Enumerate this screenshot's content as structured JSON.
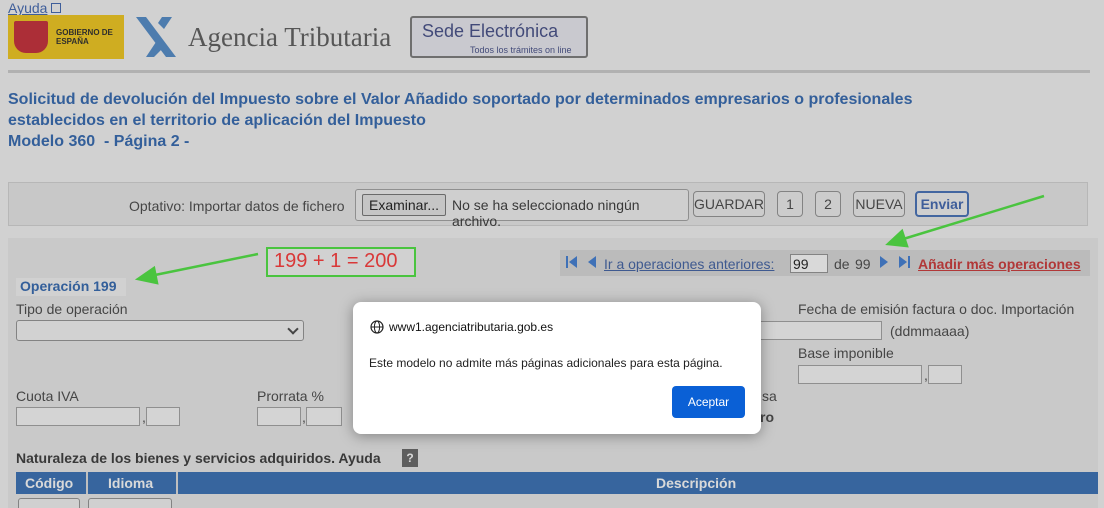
{
  "header": {
    "help_label": "Ayuda",
    "gov_logo_text": "GOBIERNO DE ESPAÑA",
    "agency_name": "Agencia Tributaria",
    "sede_title": "Sede Electrónica",
    "sede_subtitle": "Todos los trámites on line"
  },
  "title": {
    "line1": "Solicitud de devolución del Impuesto sobre el Valor Añadido soportado por determinados empresarios o profesionales",
    "line2": "establecidos en el territorio de aplicación del Impuesto",
    "line3": "Modelo 360  - Página 2 -"
  },
  "toolbar": {
    "import_label": "Optativo: Importar datos de fichero",
    "browse_label": "Examinar...",
    "file_status": "No se ha seleccionado ningún archivo.",
    "save_label": "GUARDAR",
    "page1_label": "1",
    "page2_label": "2",
    "new_label": "NUEVA",
    "send_label": "Enviar"
  },
  "nav": {
    "prev_ops_label": "Ir a operaciones anteriores:",
    "current_value": "99",
    "of_label": "de",
    "total": "99",
    "add_ops_label": "Añadir más operaciones"
  },
  "annotation": {
    "text": "199 + 1 = 200"
  },
  "operation": {
    "title": "Operación 199",
    "tipo_label": "Tipo de operación",
    "fecha_label": "Fecha de emisión factura o doc. Importación",
    "fecha_format": "(ddmmaaaa)",
    "base_label": "Base imponible",
    "cuota_label": "Cuota IVA",
    "prorrata_label": "Prorrata %",
    "partial_label_1": "sa",
    "partial_label_2": "ro"
  },
  "goods": {
    "title": "Naturaleza de los bienes y servicios adquiridos. Ayuda",
    "help_symbol": "?",
    "col_code": "Código",
    "col_language": "Idioma",
    "col_description": "Descripción"
  },
  "dialog": {
    "origin": "www1.agenciatributaria.gob.es",
    "message": "Este modelo no admite más páginas adicionales para esta página.",
    "accept_label": "Aceptar"
  },
  "colors": {
    "title_blue": "#1a56a8",
    "annotation_green": "#3ae22a",
    "annotation_red": "#ff2020",
    "dialog_button": "#0a60d6",
    "table_header": "#1f5fae"
  }
}
